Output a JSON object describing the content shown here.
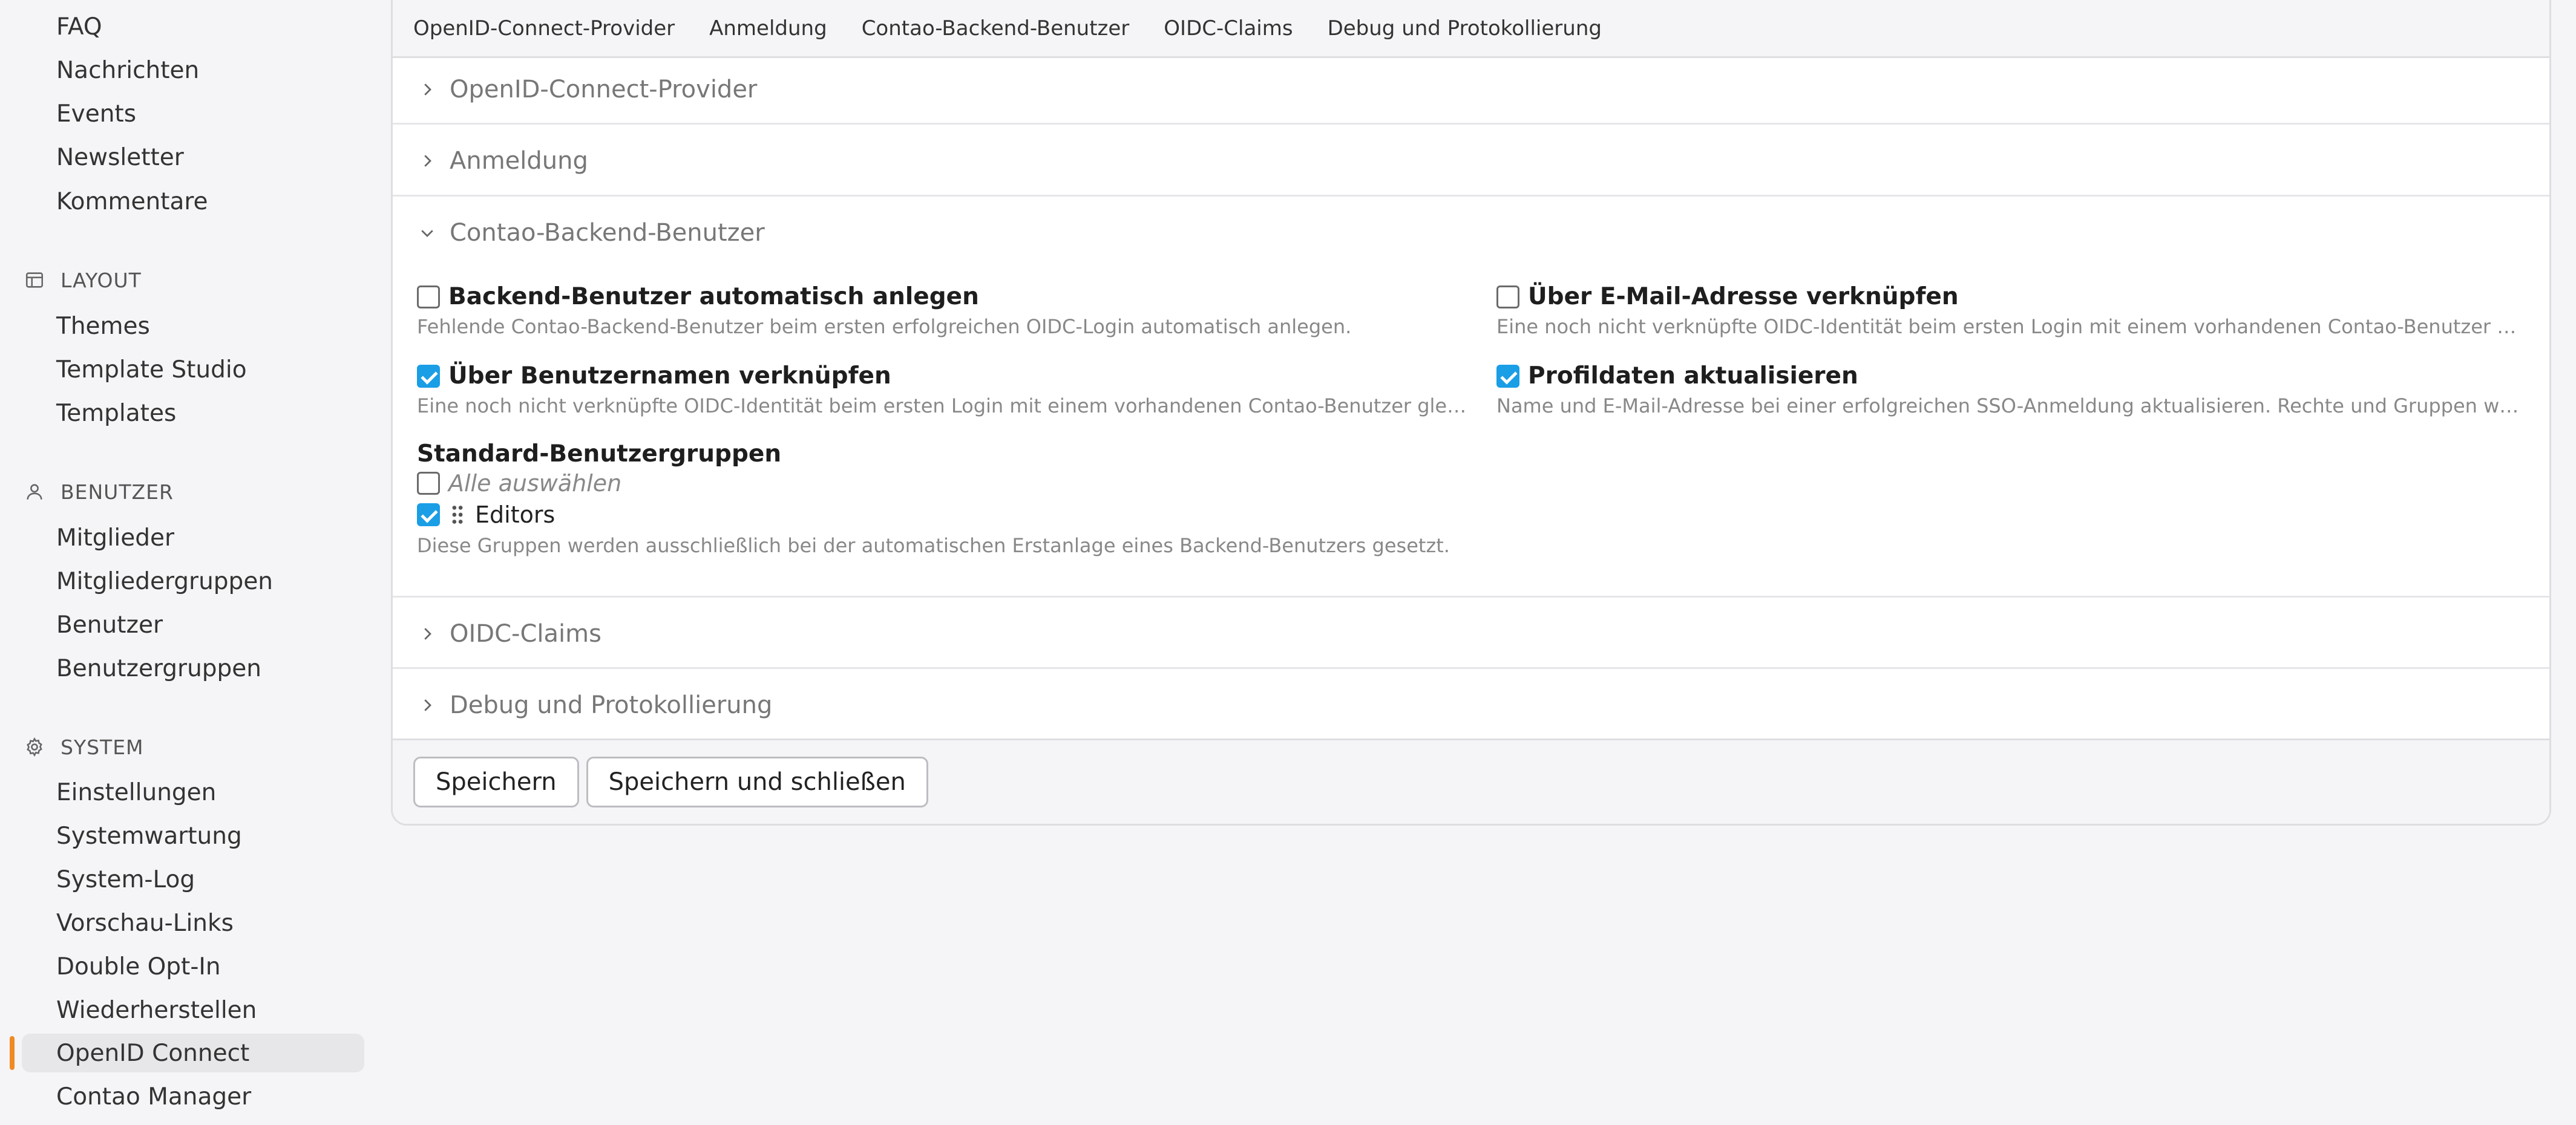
{
  "sidebar": {
    "content_items": [
      {
        "label": "FAQ"
      },
      {
        "label": "Nachrichten"
      },
      {
        "label": "Events"
      },
      {
        "label": "Newsletter"
      },
      {
        "label": "Kommentare"
      }
    ],
    "sections": [
      {
        "label": "LAYOUT",
        "icon": "layout-icon",
        "items": [
          {
            "label": "Themes"
          },
          {
            "label": "Template Studio"
          },
          {
            "label": "Templates"
          }
        ]
      },
      {
        "label": "BENUTZER",
        "icon": "user-icon",
        "items": [
          {
            "label": "Mitglieder"
          },
          {
            "label": "Mitgliedergruppen"
          },
          {
            "label": "Benutzer"
          },
          {
            "label": "Benutzergruppen"
          }
        ]
      },
      {
        "label": "SYSTEM",
        "icon": "gear-icon",
        "items": [
          {
            "label": "Einstellungen"
          },
          {
            "label": "Systemwartung"
          },
          {
            "label": "System-Log"
          },
          {
            "label": "Vorschau-Links"
          },
          {
            "label": "Double Opt-In"
          },
          {
            "label": "Wiederherstellen"
          },
          {
            "label": "OpenID Connect"
          },
          {
            "label": "Contao Manager"
          }
        ]
      }
    ],
    "active_item": "OpenID Connect",
    "accent_color": "#f08a24"
  },
  "tabs": [
    {
      "label": "OpenID-Connect-Provider"
    },
    {
      "label": "Anmeldung"
    },
    {
      "label": "Contao-Backend-Benutzer"
    },
    {
      "label": "OIDC-Claims"
    },
    {
      "label": "Debug und Protokollierung"
    }
  ],
  "fieldsets": [
    {
      "legend": "OpenID-Connect-Provider",
      "expanded": false
    },
    {
      "legend": "Anmeldung",
      "expanded": false
    },
    {
      "legend": "Contao-Backend-Benutzer",
      "expanded": true
    },
    {
      "legend": "OIDC-Claims",
      "expanded": false
    },
    {
      "legend": "Debug und Protokollierung",
      "expanded": false
    }
  ],
  "backend_user": {
    "auto_create": {
      "label": "Backend-Benutzer automatisch anlegen",
      "description": "Fehlende Contao-Backend-Benutzer beim ersten erfolgreichen OIDC-Login automatisch anlegen.",
      "checked": false
    },
    "link_email": {
      "label": "Über E-Mail-Adresse verknüpfen",
      "description": "Eine noch nicht verknüpfte OIDC-Identität beim ersten Login mit einem vorhandenen Contao-Benutzer gleiche…",
      "checked": false
    },
    "link_username": {
      "label": "Über Benutzernamen verknüpfen",
      "description": "Eine noch nicht verknüpfte OIDC-Identität beim ersten Login mit einem vorhandenen Contao-Benutzer gleiche…",
      "checked": true
    },
    "update_profile": {
      "label": "Profildaten aktualisieren",
      "description": "Name und E-Mail-Adresse bei einer erfolgreichen SSO-Anmeldung aktualisieren. Rechte und Gruppen werden …",
      "checked": true
    },
    "default_groups": {
      "label": "Standard-Benutzergruppen",
      "select_all": "Alle auswählen",
      "options": [
        {
          "label": "Editors",
          "checked": true
        }
      ],
      "description": "Diese Gruppen werden ausschließlich bei der automatischen Erstanlage eines Backend-Benutzers gesetzt."
    }
  },
  "footer": {
    "save_label": "Speichern",
    "save_close_label": "Speichern und schließen"
  },
  "colors": {
    "checkbox_checked": "#1a9ee6"
  }
}
